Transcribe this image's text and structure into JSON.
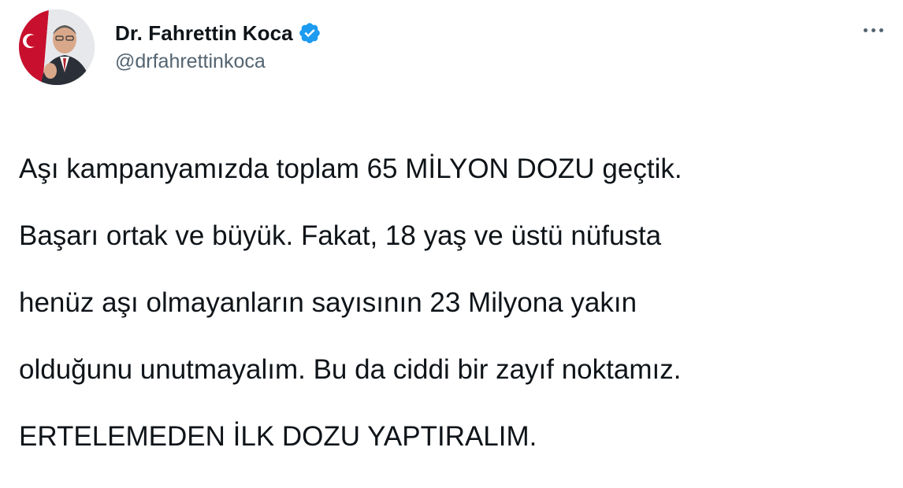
{
  "author": {
    "display_name": "Dr. Fahrettin Koca",
    "handle": "@drfahrettinkoca",
    "verified": true,
    "avatar_icon": "profile-photo"
  },
  "menu": {
    "icon": "more-horizontal-icon"
  },
  "tweet": {
    "lines": [
      "Aşı kampanyamızda toplam 65 MİLYON DOZU geçtik.",
      "Başarı ortak ve büyük. Fakat, 18 yaş ve üstü nüfusta",
      "henüz aşı olmayanların sayısının 23 Milyona yakın",
      "olduğunu unutmayalım. Bu da ciddi bir zayıf noktamız.",
      "ERTELEMEDEN İLK DOZU YAPTIRALIM."
    ]
  },
  "colors": {
    "text_primary": "#0f1419",
    "text_secondary": "#536471",
    "verified_blue": "#1d9bf0",
    "background": "#ffffff"
  }
}
